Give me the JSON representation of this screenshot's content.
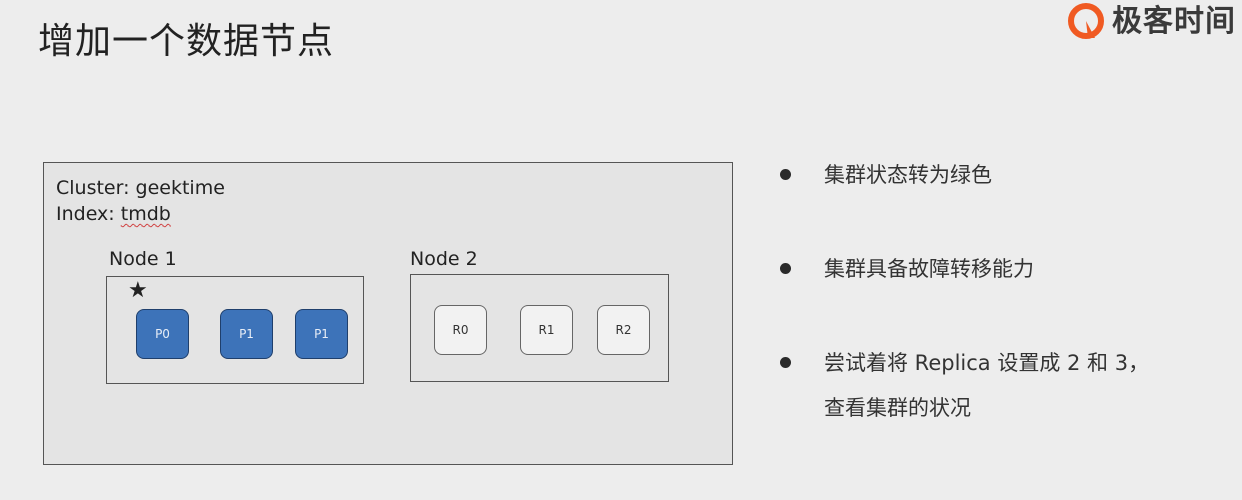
{
  "title": "增加一个数据节点",
  "brand": {
    "name": "极客时间",
    "accent_color": "#f05a22",
    "icon": "brand-logo-icon"
  },
  "cluster": {
    "cluster_line": "Cluster: geektime",
    "index_prefix": "Index: ",
    "index_value": "tmdb",
    "nodes": [
      {
        "label": "Node 1",
        "is_master": true,
        "master_icon": "star-icon",
        "shards": [
          {
            "label": "P0",
            "type": "primary"
          },
          {
            "label": "P1",
            "type": "primary"
          },
          {
            "label": "P1",
            "type": "primary"
          }
        ]
      },
      {
        "label": "Node 2",
        "is_master": false,
        "shards": [
          {
            "label": "R0",
            "type": "replica"
          },
          {
            "label": "R1",
            "type": "replica"
          },
          {
            "label": "R2",
            "type": "replica"
          }
        ]
      }
    ],
    "colors": {
      "primary_shard": "#3d73b9",
      "replica_shard": "#f2f2f2"
    }
  },
  "bullets": [
    {
      "text": "集群状态转为绿色"
    },
    {
      "text": "集群具备故障转移能力"
    },
    {
      "line1": "尝试着将 Replica 设置成 2 和 3，",
      "line2": "查看集群的状况"
    }
  ]
}
